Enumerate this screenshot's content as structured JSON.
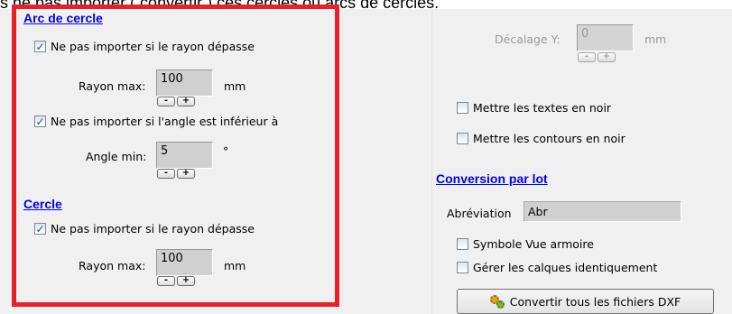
{
  "header_fragment": "s ne pas importer ( convertir ) ces cercles ou arcs de cercles.",
  "arc": {
    "title": "Arc de cercle",
    "radius_check_label": "Ne pas importer si le rayon dépasse",
    "radius_checked": true,
    "radius_label": "Rayon max:",
    "radius_value": "100",
    "radius_unit": "mm",
    "angle_check_label": "Ne pas importer si l'angle est inférieur à",
    "angle_checked": true,
    "angle_label": "Angle min:",
    "angle_value": "5",
    "angle_unit": "°"
  },
  "cercle": {
    "title": "Cercle",
    "radius_check_label": "Ne pas importer si le rayon dépasse",
    "radius_checked": true,
    "radius_label": "Rayon max:",
    "radius_value": "100",
    "radius_unit": "mm"
  },
  "stepper": {
    "minus": "-",
    "plus": "+"
  },
  "right": {
    "offset_y_label": "Décalage Y:",
    "offset_y_value": "0",
    "offset_y_unit": "mm",
    "text_black_label": "Mettre les textes en noir",
    "text_black_checked": false,
    "contours_black_label": "Mettre les contours en noir",
    "contours_black_checked": false
  },
  "batch": {
    "title": "Conversion par lot",
    "abbrev_label": "Abréviation",
    "abbrev_value": "Abr",
    "wardrobe_symbol_label": "Symbole Vue armoire",
    "wardrobe_symbol_checked": false,
    "layers_label": "Gérer les calques identiquement",
    "layers_checked": false,
    "convert_button": "Convertir tous les fichiers DXF"
  },
  "colors": {
    "highlight": "#e8202a",
    "link_blue": "#0000ee",
    "panel_bg": "#f0f0f0"
  }
}
